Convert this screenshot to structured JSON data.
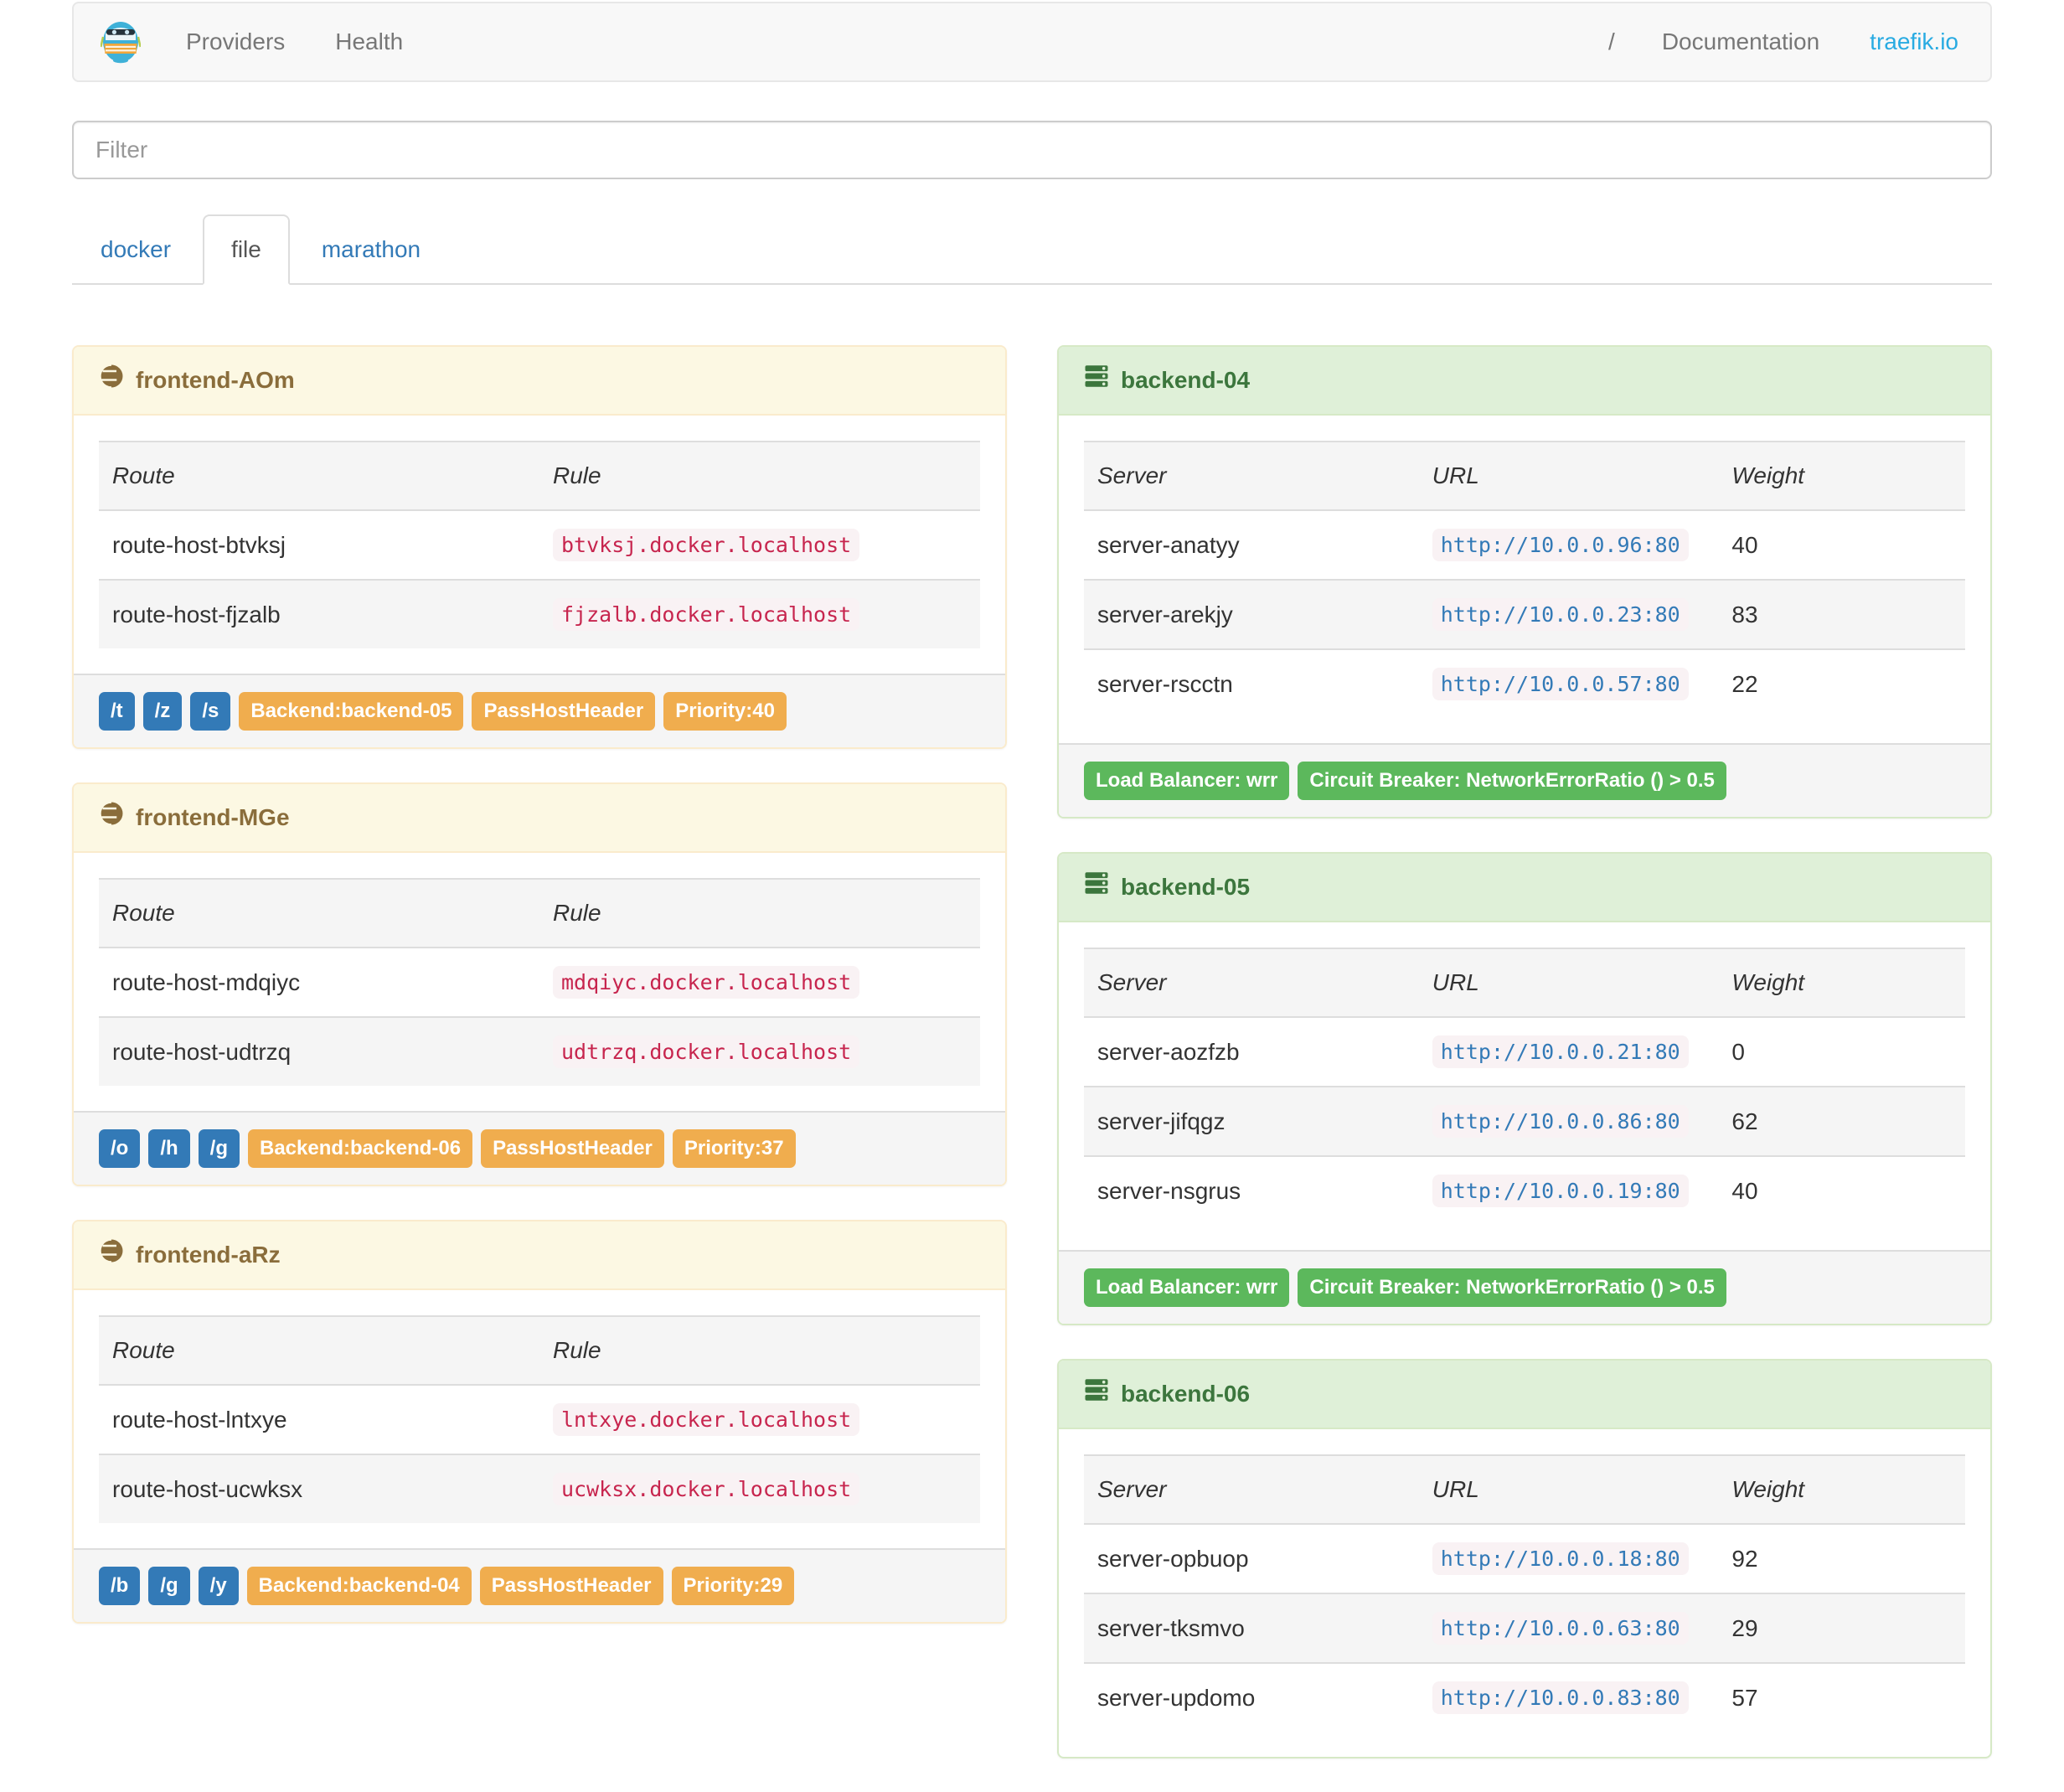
{
  "navbar": {
    "providers_label": "Providers",
    "health_label": "Health",
    "slash_label": "/",
    "documentation_label": "Documentation",
    "traefik_link_label": "traefik.io"
  },
  "filter": {
    "placeholder": "Filter"
  },
  "tabs": {
    "docker": "docker",
    "file": "file",
    "marathon": "marathon"
  },
  "table_headers": {
    "route": "Route",
    "rule": "Rule",
    "server": "Server",
    "url": "URL",
    "weight": "Weight"
  },
  "frontends": [
    {
      "title": "frontend-AOm",
      "routes": [
        {
          "route": "route-host-btvksj",
          "rule": "btvksj.docker.localhost"
        },
        {
          "route": "route-host-fjzalb",
          "rule": "fjzalb.docker.localhost"
        }
      ],
      "entry_points": [
        "/t",
        "/z",
        "/s"
      ],
      "tags": [
        "Backend:backend-05",
        "PassHostHeader",
        "Priority:40"
      ]
    },
    {
      "title": "frontend-MGe",
      "routes": [
        {
          "route": "route-host-mdqiyc",
          "rule": "mdqiyc.docker.localhost"
        },
        {
          "route": "route-host-udtrzq",
          "rule": "udtrzq.docker.localhost"
        }
      ],
      "entry_points": [
        "/o",
        "/h",
        "/g"
      ],
      "tags": [
        "Backend:backend-06",
        "PassHostHeader",
        "Priority:37"
      ]
    },
    {
      "title": "frontend-aRz",
      "routes": [
        {
          "route": "route-host-lntxye",
          "rule": "lntxye.docker.localhost"
        },
        {
          "route": "route-host-ucwksx",
          "rule": "ucwksx.docker.localhost"
        }
      ],
      "entry_points": [
        "/b",
        "/g",
        "/y"
      ],
      "tags": [
        "Backend:backend-04",
        "PassHostHeader",
        "Priority:29"
      ]
    }
  ],
  "backends": [
    {
      "title": "backend-04",
      "servers": [
        {
          "name": "server-anatyy",
          "url": "http://10.0.0.96:80",
          "weight": "40"
        },
        {
          "name": "server-arekjy",
          "url": "http://10.0.0.23:80",
          "weight": "83"
        },
        {
          "name": "server-rscctn",
          "url": "http://10.0.0.57:80",
          "weight": "22"
        }
      ],
      "badges": [
        "Load Balancer: wrr",
        "Circuit Breaker: NetworkErrorRatio () > 0.5"
      ]
    },
    {
      "title": "backend-05",
      "servers": [
        {
          "name": "server-aozfzb",
          "url": "http://10.0.0.21:80",
          "weight": "0"
        },
        {
          "name": "server-jifqgz",
          "url": "http://10.0.0.86:80",
          "weight": "62"
        },
        {
          "name": "server-nsgrus",
          "url": "http://10.0.0.19:80",
          "weight": "40"
        }
      ],
      "badges": [
        "Load Balancer: wrr",
        "Circuit Breaker: NetworkErrorRatio () > 0.5"
      ]
    },
    {
      "title": "backend-06",
      "servers": [
        {
          "name": "server-opbuop",
          "url": "http://10.0.0.18:80",
          "weight": "92"
        },
        {
          "name": "server-tksmvo",
          "url": "http://10.0.0.63:80",
          "weight": "29"
        },
        {
          "name": "server-updomo",
          "url": "http://10.0.0.83:80",
          "weight": "57"
        }
      ]
    }
  ],
  "colors": {
    "accent_link": "#29abe2",
    "tab_link": "#337ab7",
    "warning_heading_bg": "#fcf8e3",
    "warning_text": "#8a6d3b",
    "success_heading_bg": "#dff0d8",
    "success_text": "#3c763d",
    "label_primary": "#337ab7",
    "label_warning": "#f0ad4e",
    "label_success": "#5cb85c",
    "code_text": "#c7254e",
    "code_bg": "#f9f2f4",
    "url_text": "#337ab7"
  }
}
